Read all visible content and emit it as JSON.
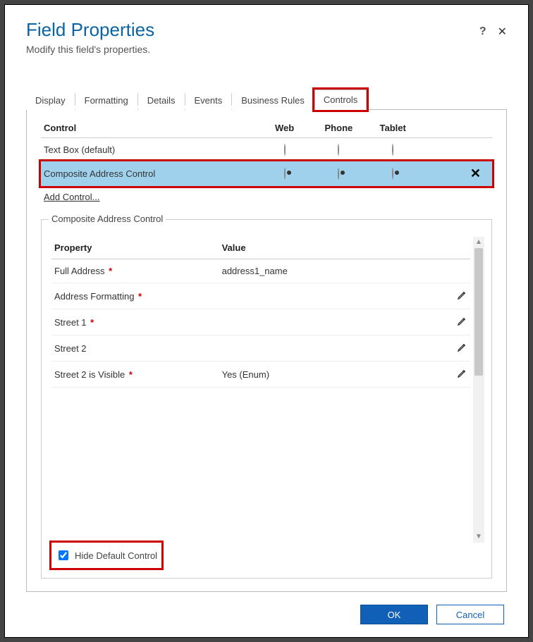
{
  "dialog": {
    "title": "Field Properties",
    "subtitle": "Modify this field's properties."
  },
  "tabs": {
    "items": [
      {
        "label": "Display"
      },
      {
        "label": "Formatting"
      },
      {
        "label": "Details"
      },
      {
        "label": "Events"
      },
      {
        "label": "Business Rules"
      },
      {
        "label": "Controls"
      }
    ],
    "active_index": 5
  },
  "controls_table": {
    "headers": {
      "control": "Control",
      "web": "Web",
      "phone": "Phone",
      "tablet": "Tablet"
    },
    "rows": [
      {
        "name": "Text Box (default)",
        "web": false,
        "phone": false,
        "tablet": false,
        "selected": false
      },
      {
        "name": "Composite Address Control",
        "web": true,
        "phone": true,
        "tablet": true,
        "selected": true
      }
    ],
    "add_control_label": "Add Control..."
  },
  "fieldset": {
    "legend": "Composite Address Control",
    "headers": {
      "property": "Property",
      "value": "Value"
    },
    "rows": [
      {
        "property": "Full Address",
        "required": true,
        "value": "address1_name",
        "editable": false
      },
      {
        "property": "Address Formatting",
        "required": true,
        "value": "",
        "editable": true
      },
      {
        "property": "Street 1",
        "required": true,
        "value": "",
        "editable": true
      },
      {
        "property": "Street 2",
        "required": false,
        "value": "",
        "editable": true
      },
      {
        "property": "Street 2 is Visible",
        "required": true,
        "value": "Yes (Enum)",
        "editable": true
      }
    ],
    "hide_default_label": "Hide Default Control",
    "hide_default_checked": true
  },
  "footer": {
    "ok": "OK",
    "cancel": "Cancel"
  }
}
